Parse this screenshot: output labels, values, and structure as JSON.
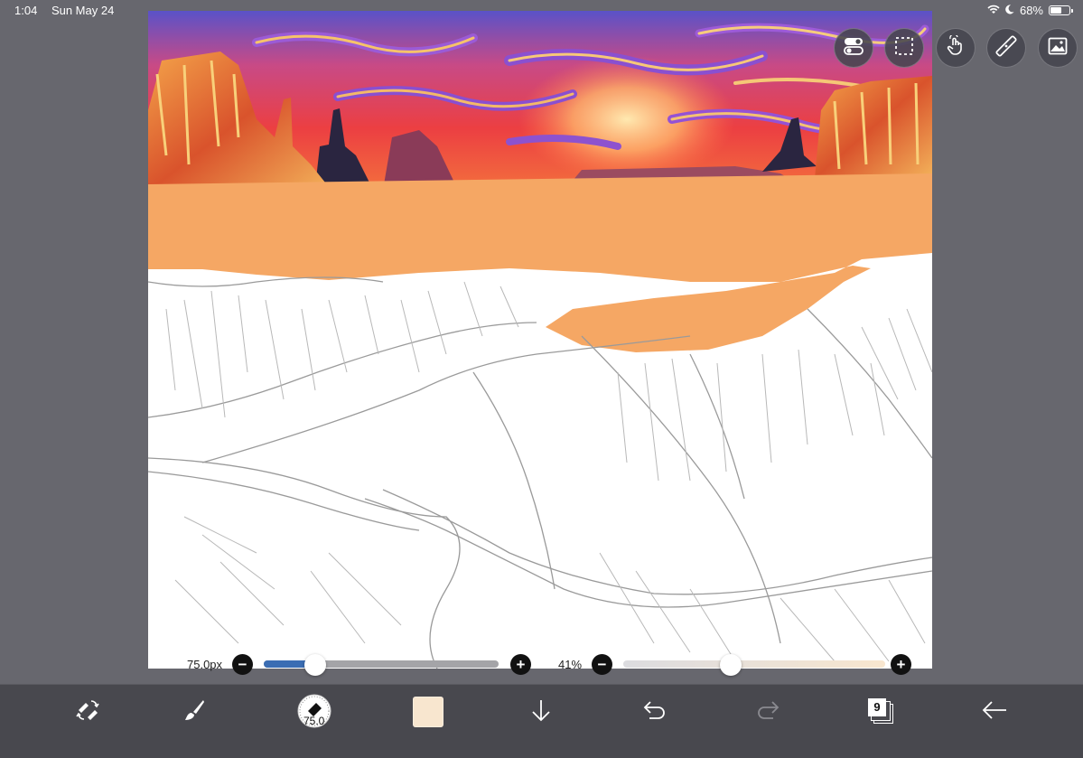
{
  "status_bar": {
    "time": "1:04",
    "date": "Sun May 24",
    "battery_percent": "68%",
    "battery_level": 0.68,
    "icons": [
      "wifi-icon",
      "moon-icon",
      "battery-icon"
    ]
  },
  "floating_tools": [
    {
      "name": "toggle-settings-button",
      "icon": "toggle-switches-icon"
    },
    {
      "name": "selection-button",
      "icon": "dashed-selection-icon"
    },
    {
      "name": "touch-gesture-button",
      "icon": "hand-pointer-icon"
    },
    {
      "name": "ruler-button",
      "icon": "ruler-icon"
    },
    {
      "name": "material-button",
      "icon": "image-icon"
    }
  ],
  "brush_size": {
    "label": "75.0px",
    "value": 75.0,
    "slider_fraction": 0.22,
    "minus": "−",
    "plus": "+"
  },
  "opacity": {
    "label": "41%",
    "value_percent": 41,
    "minus": "−",
    "plus": "+"
  },
  "toolbar": {
    "brush_size_badge": "75.0",
    "layer_count": "9",
    "items": [
      "swap-tools-icon",
      "brush-icon",
      "eraser-preview",
      "color-swatch",
      "download-arrow-icon",
      "undo-icon",
      "redo-icon",
      "layers-icon",
      "back-arrow-icon"
    ]
  },
  "colors": {
    "accent_blue": "#3b6db3",
    "selected_color": "#f8e6cf",
    "ground_orange": "#f5a764"
  }
}
